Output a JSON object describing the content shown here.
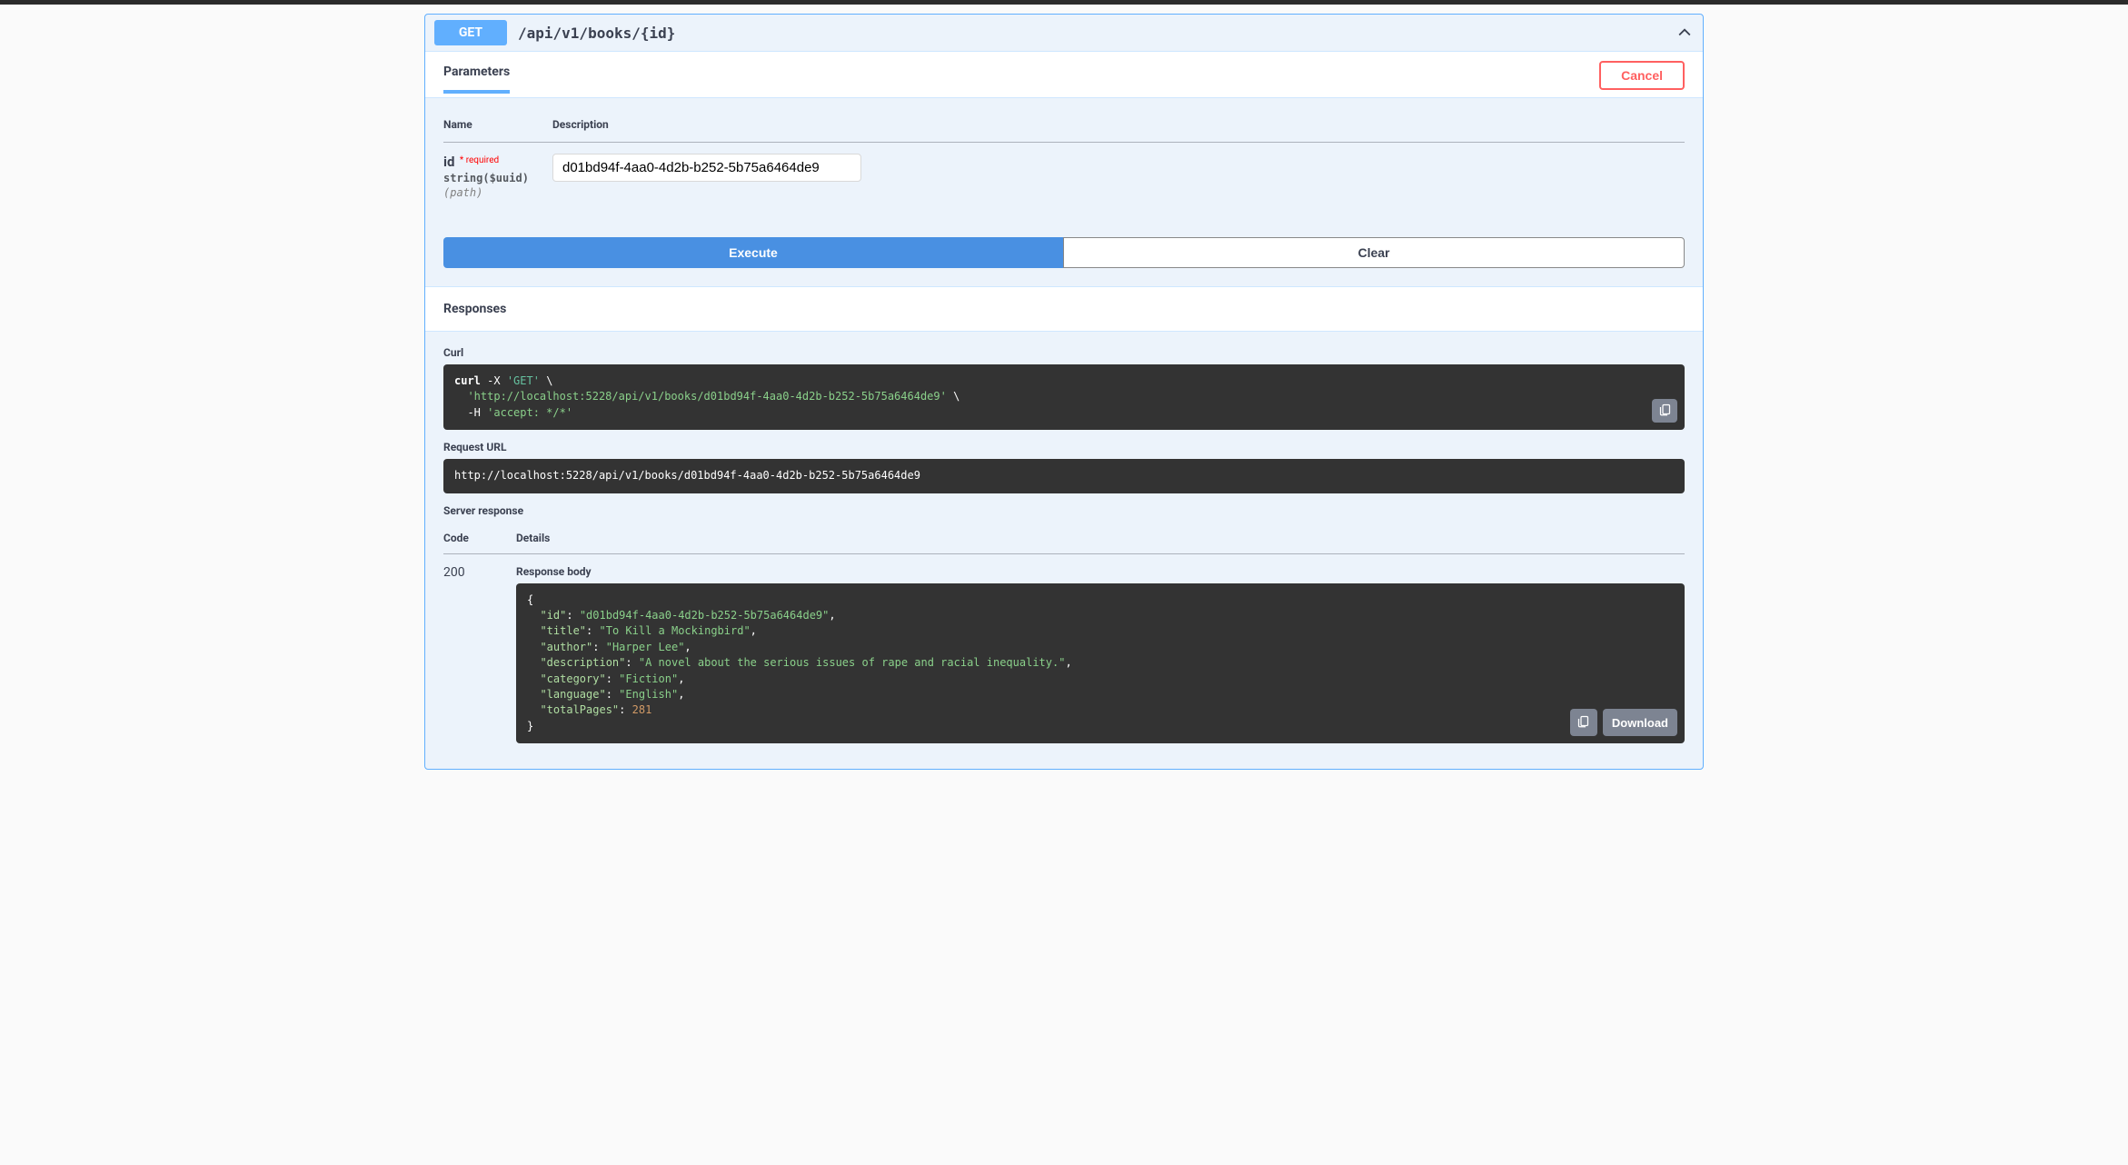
{
  "endpoint": {
    "method": "GET",
    "path": "/api/v1/books/{id}"
  },
  "tabs": {
    "parameters_label": "Parameters",
    "cancel_label": "Cancel"
  },
  "columns": {
    "name": "Name",
    "description": "Description"
  },
  "param": {
    "name": "id",
    "required_label": "* required",
    "type": "string($uuid)",
    "in": "(path)",
    "value": "d01bd94f-4aa0-4d2b-b252-5b75a6464de9"
  },
  "buttons": {
    "execute": "Execute",
    "clear": "Clear",
    "download": "Download"
  },
  "responses_header": "Responses",
  "curl": {
    "label": "Curl",
    "cmd": "curl",
    "opt_x": "-X",
    "method": "'GET'",
    "backslash": "\\",
    "url": "'http://localhost:5228/api/v1/books/d01bd94f-4aa0-4d2b-b252-5b75a6464de9'",
    "opt_h": "-H",
    "header": "'accept: */*'"
  },
  "request_url": {
    "label": "Request URL",
    "value": "http://localhost:5228/api/v1/books/d01bd94f-4aa0-4d2b-b252-5b75a6464de9"
  },
  "server_response_label": "Server response",
  "resp_columns": {
    "code": "Code",
    "details": "Details"
  },
  "response": {
    "code": "200",
    "body_label": "Response body",
    "json": {
      "id": "d01bd94f-4aa0-4d2b-b252-5b75a6464de9",
      "title": "To Kill a Mockingbird",
      "author": "Harper Lee",
      "description": "A novel about the serious issues of rape and racial inequality.",
      "category": "Fiction",
      "language": "English",
      "totalPages": 281
    }
  },
  "colors": {
    "method_bg": "#61affe",
    "execute_bg": "#4990e2",
    "cancel_border": "#ff6060",
    "code_bg": "#333333"
  }
}
